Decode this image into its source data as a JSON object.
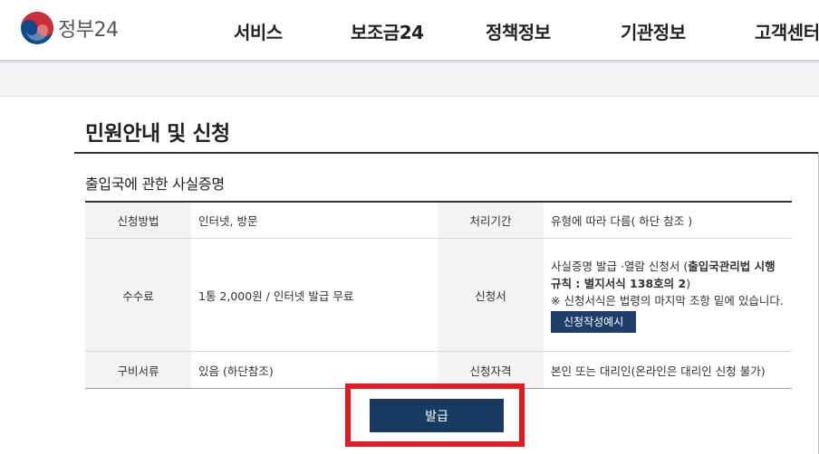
{
  "header": {
    "logo_text": "정부24",
    "nav": [
      "서비스",
      "보조금24",
      "정책정보",
      "기관정보",
      "고객센터"
    ]
  },
  "page": {
    "title": "민원안내 및 신청",
    "section_title": "출입국에 관한 사실증명"
  },
  "info_table": {
    "apply_method_label": "신청방법",
    "apply_method_value": "인터넷, 방문",
    "processing_period_label": "처리기간",
    "processing_period_value": "유형에 따라 다름( 하단 참조 )",
    "fee_label": "수수료",
    "fee_value": "1통 2,000원 / 인터넷 발급 무료",
    "form_label": "신청서",
    "form_value_prefix": "사실증명 발급 ·열람 신청서 (",
    "form_value_bold": "출입국관리법 시행규칙 : 별지서식 138호의 2",
    "form_value_suffix": ")",
    "form_note": "※ 신청서식은 법령의 마지막 조항 밑에 있습니다.",
    "form_example_button": "신청작성예시",
    "documents_label": "구비서류",
    "documents_value": "있음 (하단참조)",
    "eligibility_label": "신청자격",
    "eligibility_value": "본인 또는 대리인(온라인은 대리인 신청 불가)"
  },
  "actions": {
    "issue_button": "발급"
  },
  "colors": {
    "primary_navy": "#173a61",
    "highlight_red": "#e31b23",
    "logo_red": "#cd2e3a",
    "logo_blue": "#0f4a8a"
  }
}
